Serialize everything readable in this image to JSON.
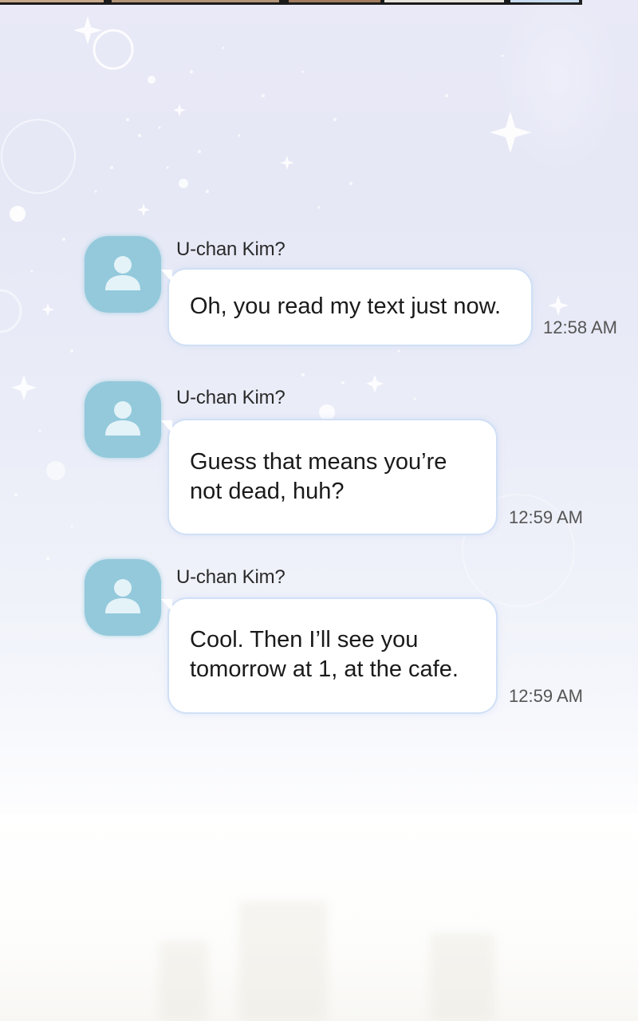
{
  "messages": [
    {
      "sender": "U-chan Kim?",
      "text_lines": [
        "Oh, you read my text just now."
      ],
      "time": "12:58 AM",
      "avatar_icon": "person-icon"
    },
    {
      "sender": "U-chan Kim?",
      "text_lines": [
        "Guess that means you’re",
        "not dead, huh?"
      ],
      "time": "12:59 AM",
      "avatar_icon": "person-icon"
    },
    {
      "sender": "U-chan Kim?",
      "text_lines": [
        "Cool. Then I’ll see you",
        "tomorrow at 1, at the cafe."
      ],
      "time": "12:59 AM",
      "avatar_icon": "person-icon"
    }
  ],
  "colors": {
    "avatar": "#93c9db",
    "avatar_glyph": "#e4f3f8",
    "bubble": "#ffffff",
    "background_top": "#e6e8f6",
    "text": "#1a1a1a"
  }
}
